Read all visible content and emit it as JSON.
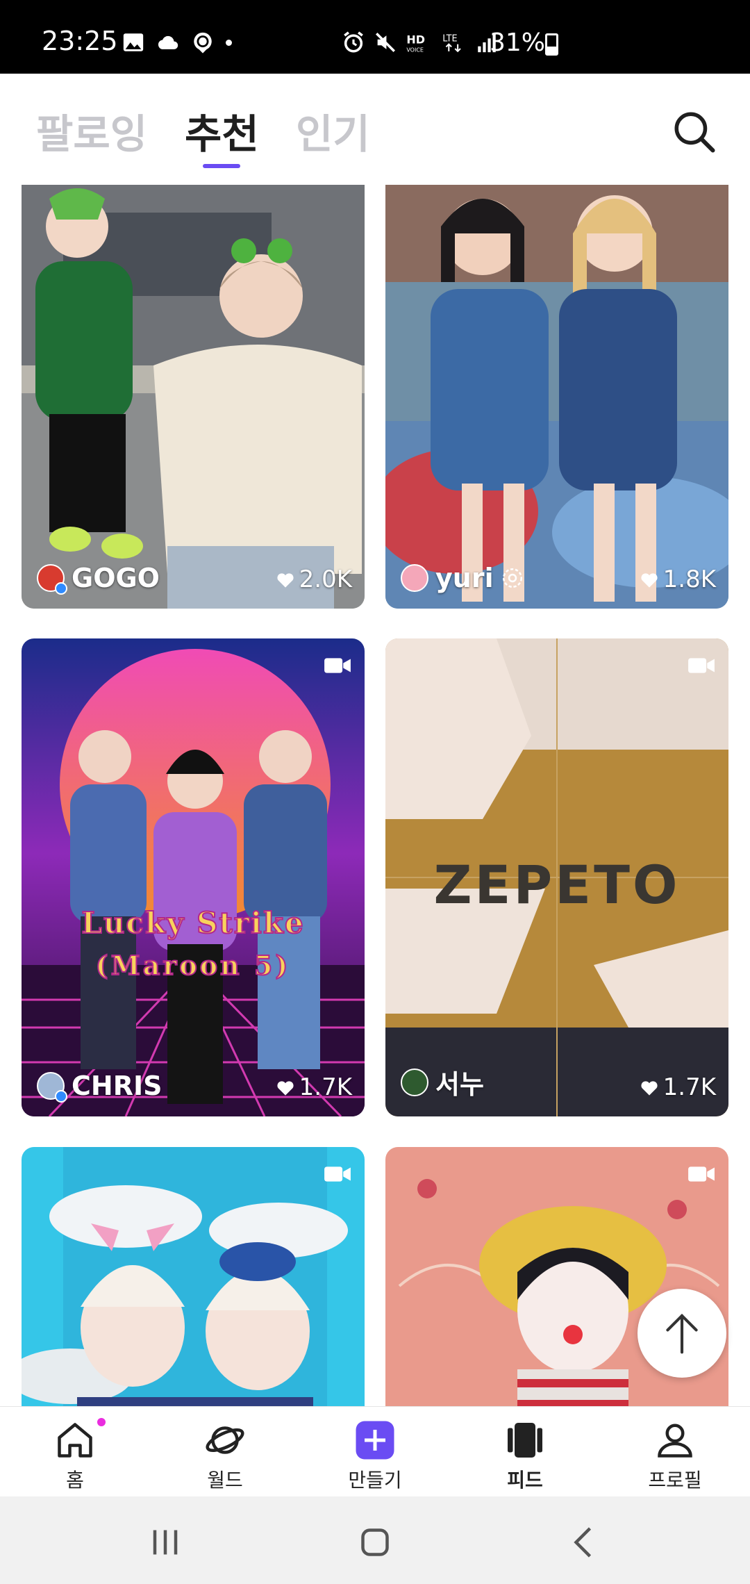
{
  "status_bar": {
    "time": "23:25",
    "battery": "31%",
    "icons": [
      "gallery-icon",
      "cloud-icon",
      "zepeto-icon",
      "alarm-icon",
      "mute-icon",
      "hd-voice-icon",
      "lte-icon",
      "signal-icon",
      "battery-icon"
    ]
  },
  "tabs": [
    {
      "label": "팔로잉",
      "active": false
    },
    {
      "label": "추천",
      "active": true
    },
    {
      "label": "인기",
      "active": false
    }
  ],
  "accent_color": "#6a4cf3",
  "feed": [
    {
      "author": "GOGO",
      "likes": "2.0K",
      "verified": true,
      "video": false
    },
    {
      "author": "yuri",
      "likes": "1.8K",
      "verified": false,
      "video": false
    },
    {
      "author": "CHRIS",
      "likes": "1.7K",
      "verified": true,
      "video": true,
      "overlay_lines": [
        "Lucky Strike",
        "(Maroon 5)"
      ]
    },
    {
      "author": "서누",
      "likes": "1.7K",
      "verified": false,
      "video": true,
      "overlay_lines": [
        "ZEPETO"
      ]
    },
    {
      "author": "",
      "likes": "",
      "verified": false,
      "video": true
    },
    {
      "author": "",
      "likes": "",
      "verified": false,
      "video": true
    }
  ],
  "bottom_nav": [
    {
      "label": "홈",
      "icon": "home-icon",
      "badge": true
    },
    {
      "label": "월드",
      "icon": "planet-icon",
      "badge": false
    },
    {
      "label": "만들기",
      "icon": "plus-icon",
      "badge": false
    },
    {
      "label": "피드",
      "icon": "feed-icon",
      "badge": false
    },
    {
      "label": "프로필",
      "icon": "profile-icon",
      "badge": false
    }
  ]
}
